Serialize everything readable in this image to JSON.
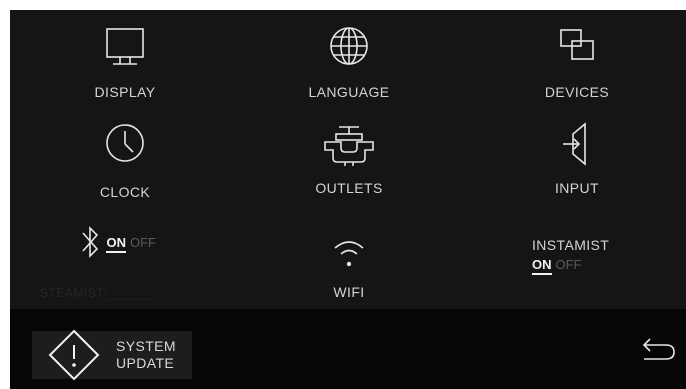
{
  "menu": {
    "display_label": "DISPLAY",
    "language_label": "LANGUAGE",
    "devices_label": "DEVICES",
    "clock_label": "CLOCK",
    "outlets_label": "OUTLETS",
    "input_label": "INPUT",
    "wifi_label": "WIFI"
  },
  "bluetooth": {
    "icon": "bluetooth-icon",
    "on_label": "ON",
    "off_label": "OFF",
    "state": "on"
  },
  "instamist": {
    "label": "INSTAMIST",
    "on_label": "ON",
    "off_label": "OFF",
    "state": "on"
  },
  "steamist": {
    "text": "STEAMIST-______"
  },
  "footer": {
    "system_update_line1": "SYSTEM",
    "system_update_line2": "UPDATE",
    "back_icon": "back-arrow-icon"
  },
  "colors": {
    "background": "#151515",
    "footer": "#060606",
    "text": "#d9d9d9",
    "muted": "#5a5a5a"
  }
}
